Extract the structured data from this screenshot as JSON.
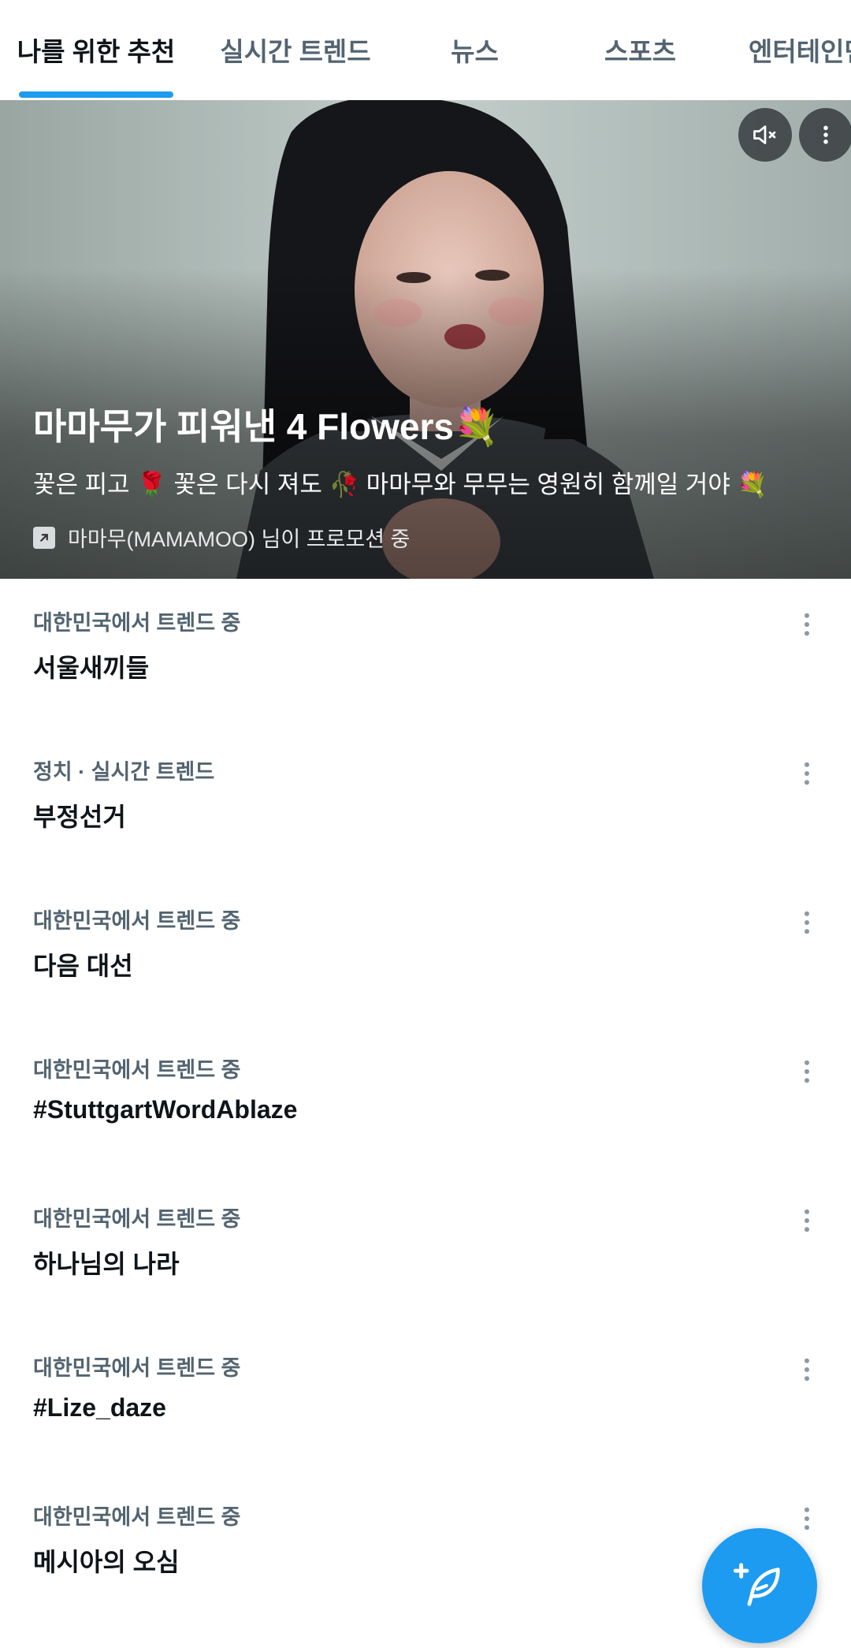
{
  "tabs": [
    {
      "label": "나를 위한 추천",
      "active": true
    },
    {
      "label": "실시간 트렌드",
      "active": false
    },
    {
      "label": "뉴스",
      "active": false
    },
    {
      "label": "스포츠",
      "active": false
    },
    {
      "label": "엔터테인먼트",
      "active": false
    }
  ],
  "hero": {
    "title": "마마무가 피워낸 4 Flowers💐",
    "description": "꽃은 피고 🌹 꽃은 다시 져도 🥀 마마무와 무무는 영원히 함께일 거야 💐",
    "promoted_by": "마마무(MAMAMOO) 님이 프로모션 중",
    "mute_icon": "volume-muted-icon",
    "more_icon": "more-vertical-icon"
  },
  "trends": [
    {
      "meta": "대한민국에서 트렌드 중",
      "name": "서울새끼들"
    },
    {
      "meta": "정치 · 실시간 트렌드",
      "name": "부정선거"
    },
    {
      "meta": "대한민국에서 트렌드 중",
      "name": "다음 대선"
    },
    {
      "meta": "대한민국에서 트렌드 중",
      "name": "#StuttgartWordAblaze"
    },
    {
      "meta": "대한민국에서 트렌드 중",
      "name": "하나님의 나라"
    },
    {
      "meta": "대한민국에서 트렌드 중",
      "name": "#Lize_daze"
    },
    {
      "meta": "대한민국에서 트렌드 중",
      "name": "메시아의 오심"
    }
  ],
  "fab": {
    "icon": "compose-feather-icon"
  },
  "colors": {
    "accent": "#1d9bf0",
    "text_primary": "#0f1419",
    "text_secondary": "#536471"
  }
}
